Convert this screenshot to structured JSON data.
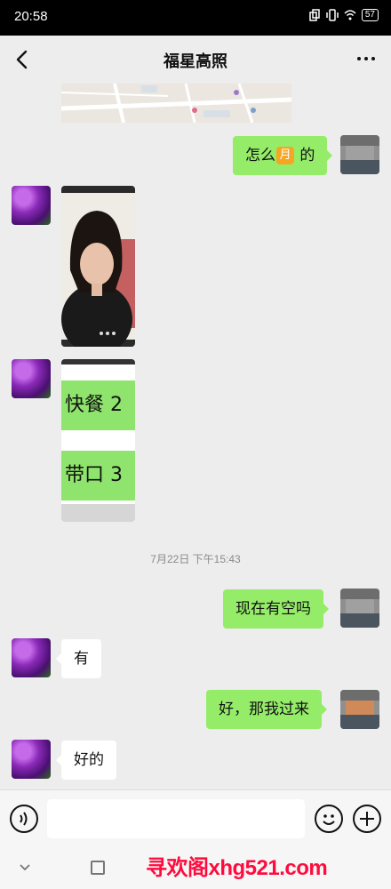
{
  "status_bar": {
    "time": "20:58",
    "battery": "57"
  },
  "header": {
    "title": "福星高照"
  },
  "messages": [
    {
      "sender": "self",
      "type": "text",
      "text_before": "怎么",
      "emoji": "月",
      "text_after": "的"
    },
    {
      "sender": "other",
      "type": "photo"
    },
    {
      "sender": "other",
      "type": "image",
      "lines": [
        "快餐 2",
        "带口 3"
      ]
    },
    {
      "type": "timestamp",
      "text": "7月22日 下午15:43"
    },
    {
      "sender": "self",
      "type": "text",
      "text": "现在有空吗"
    },
    {
      "sender": "other",
      "type": "text",
      "text": "有"
    },
    {
      "sender": "self",
      "type": "text",
      "text": "好，那我过来"
    },
    {
      "sender": "other",
      "type": "text",
      "text": "好的"
    }
  ],
  "input": {
    "placeholder": ""
  },
  "watermark": "寻欢阁xhg521.com",
  "colors": {
    "bubble_self": "#95ec69",
    "bubble_other": "#ffffff",
    "background": "#ededed",
    "watermark": "#ff0b3e"
  }
}
